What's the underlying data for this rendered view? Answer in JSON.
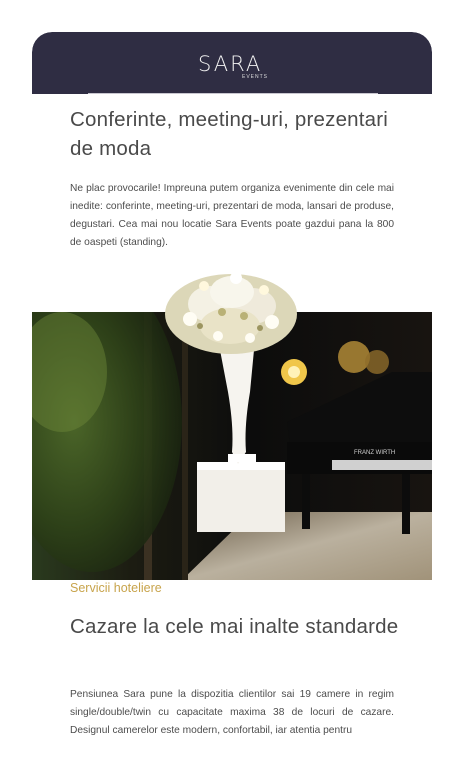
{
  "header": {
    "logo_main": "SARA",
    "logo_sub": "EVENTS"
  },
  "section1": {
    "title": "Conferinte, meeting-uri, prezentari de moda",
    "body": "Ne plac provocarile! Impreuna putem organiza evenimente din cele mai inedite: conferinte, meeting-uri, prezentari de moda, lansari de produse, degustari. Cea mai nou locatie Sara Events poate gazdui pana la 800 de oaspeti (standing)."
  },
  "photo": {
    "piano_brand": "FRANZ WIRTH"
  },
  "section2": {
    "kicker": "Servicii hoteliere",
    "title": "Cazare la cele mai inalte standarde",
    "body": "Pensiunea Sara pune la dispozitia clientilor sai 19 camere in regim single/double/twin cu capacitate maxima 38 de locuri de cazare. Designul camerelor este modern, confortabil, iar atentia pentru"
  },
  "colors": {
    "header_bg": "#2f2d43",
    "accent": "#c8a44c",
    "text": "#4a4a4a"
  }
}
